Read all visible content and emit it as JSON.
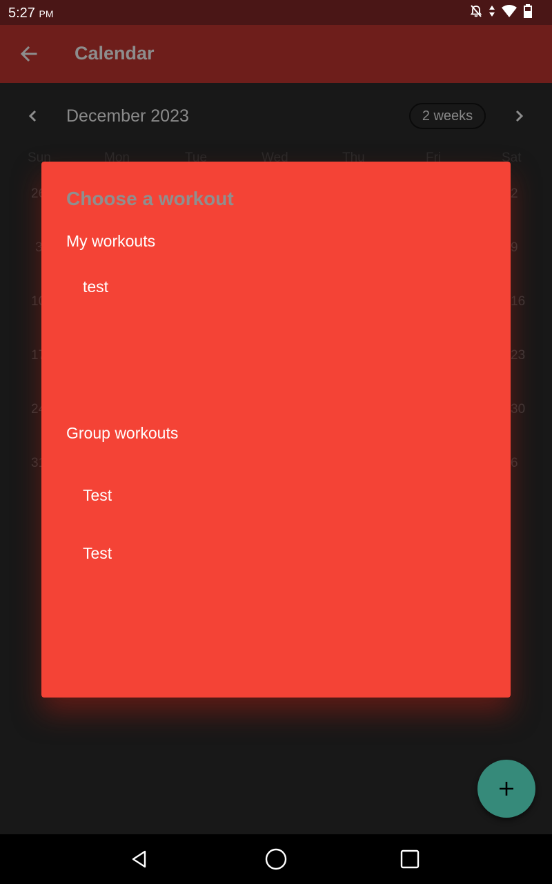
{
  "status_bar": {
    "time": "5:27",
    "ampm": "PM",
    "icons": [
      "notifications-off-icon",
      "data-arrows-icon",
      "wifi-icon",
      "battery-icon"
    ]
  },
  "app_bar": {
    "title": "Calendar",
    "back_icon": "arrow-back-icon"
  },
  "calendar": {
    "month": "December 2023",
    "format_button": "2 weeks",
    "weekdays": [
      "Sun",
      "Mon",
      "Tue",
      "Wed",
      "Thu",
      "Fri",
      "Sat"
    ],
    "left_column_days": [
      "26",
      "3",
      "10",
      "17",
      "24",
      "31"
    ],
    "right_column_days": [
      "2",
      "9",
      "16",
      "23",
      "30",
      "6"
    ]
  },
  "dialog": {
    "title": "Choose a workout",
    "my_workouts_header": "My workouts",
    "my_workouts": [
      "test"
    ],
    "group_workouts_header": "Group workouts",
    "group_workouts": [
      "Test",
      "Test"
    ]
  },
  "fab": {
    "icon": "add-icon"
  },
  "nav_bar": {
    "icons": [
      "back-triangle-icon",
      "home-circle-icon",
      "recents-square-icon"
    ]
  },
  "colors": {
    "status_bar": "#4a1616",
    "app_bar": "#6e1e1b",
    "background": "#181818",
    "dialog": "#f44336",
    "fab": "#368a7a"
  }
}
